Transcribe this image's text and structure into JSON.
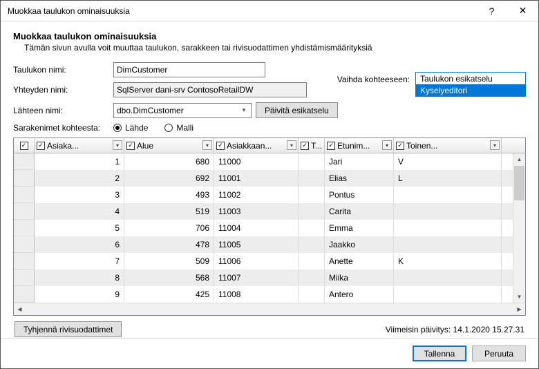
{
  "window": {
    "title": "Muokkaa taulukon ominaisuuksia"
  },
  "header": {
    "heading": "Muokkaa taulukon ominaisuuksia",
    "sub": "Tämän sivun avulla voit muuttaa taulukon, sarakkeen tai rivisuodattimen yhdistämismäärityksiä"
  },
  "form": {
    "table_name_label": "Taulukon nimi:",
    "table_name_value": "DimCustomer",
    "connection_label": "Yhteyden nimi:",
    "connection_value": "SqlServer dani-srv ContosoRetailDW",
    "source_label": "Lähteen nimi:",
    "source_value": "dbo.DimCustomer",
    "refresh_btn": "Päivitä esikatselu",
    "colnames_label": "Sarakenimet kohteesta:",
    "radio_source": "Lähde",
    "radio_model": "Malli"
  },
  "switch": {
    "label": "Vaihda kohteeseen:",
    "opt1": "Taulukon esikatselu",
    "opt2": "Kyselyeditori"
  },
  "columns": {
    "c1": "Asiaka...",
    "c2": "Alue",
    "c3": "Asiakkaan...",
    "c4": "T...",
    "c5": "Etunim...",
    "c6": "Toinen..."
  },
  "rows": [
    {
      "id": "1",
      "alue": "680",
      "asi": "11000",
      "et": "Jari",
      "toi": "V"
    },
    {
      "id": "2",
      "alue": "692",
      "asi": "11001",
      "et": "Elias",
      "toi": "L"
    },
    {
      "id": "3",
      "alue": "493",
      "asi": "11002",
      "et": "Pontus",
      "toi": ""
    },
    {
      "id": "4",
      "alue": "519",
      "asi": "11003",
      "et": "Carita",
      "toi": ""
    },
    {
      "id": "5",
      "alue": "706",
      "asi": "11004",
      "et": "Emma",
      "toi": ""
    },
    {
      "id": "6",
      "alue": "478",
      "asi": "11005",
      "et": "Jaakko",
      "toi": ""
    },
    {
      "id": "7",
      "alue": "509",
      "asi": "11006",
      "et": "Anette",
      "toi": "K"
    },
    {
      "id": "8",
      "alue": "568",
      "asi": "11007",
      "et": "Miika",
      "toi": ""
    },
    {
      "id": "9",
      "alue": "425",
      "asi": "11008",
      "et": "Antero",
      "toi": ""
    }
  ],
  "footer": {
    "clear_btn": "Tyhjennä rivisuodattimet",
    "last_update": "Viimeisin päivitys: 14.1.2020 15.27.31",
    "save": "Tallenna",
    "cancel": "Peruuta"
  }
}
